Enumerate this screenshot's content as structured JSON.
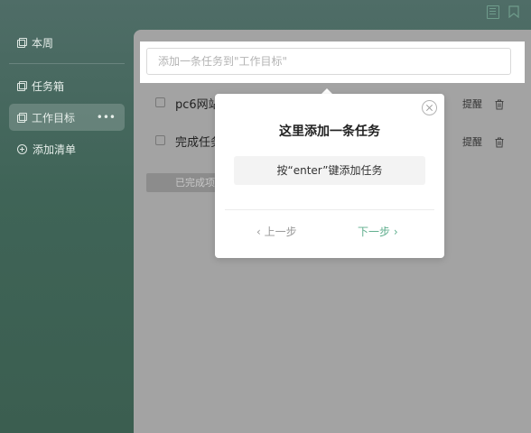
{
  "sidebar": {
    "this_week": "本周",
    "items": [
      {
        "label": "任务箱"
      },
      {
        "label": "工作目标",
        "more": "•••"
      },
      {
        "label": "添加清单"
      }
    ]
  },
  "task_input": {
    "placeholder": "添加一条任务到\"工作目标\""
  },
  "tasks": [
    {
      "title": "pc6网站",
      "remind": "提醒"
    },
    {
      "title": "完成任务",
      "remind": "提醒"
    }
  ],
  "completed_button": "已完成项",
  "popup": {
    "title": "这里添加一条任务",
    "hint": "按“enter”键添加任务",
    "prev": "‹ 上一步",
    "next": "下一步 ›"
  },
  "colors": {
    "accent": "#5fae8d",
    "overlay": "#a3a3a3"
  }
}
